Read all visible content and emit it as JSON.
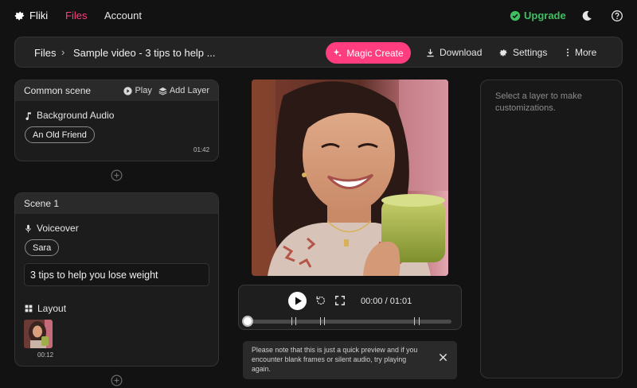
{
  "nav": {
    "brand": "Fliki",
    "files": "Files",
    "account": "Account",
    "upgrade": "Upgrade"
  },
  "toolbar": {
    "breadcrumb_root": "Files",
    "separator": "›",
    "title": "Sample video - 3 tips to help ...",
    "magic_create": "Magic Create",
    "download": "Download",
    "settings": "Settings",
    "more": "More"
  },
  "common_scene": {
    "title": "Common scene",
    "play": "Play",
    "add_layer": "Add Layer",
    "audio_label": "Background Audio",
    "audio_track": "An Old Friend",
    "duration": "01:42"
  },
  "scene1": {
    "title": "Scene 1",
    "voiceover_label": "Voiceover",
    "voice": "Sara",
    "script_text": "3 tips to help you lose weight",
    "layout_label": "Layout",
    "media_duration": "00:12"
  },
  "player": {
    "time": "00:00 / 01:01",
    "progress": 0
  },
  "notice": {
    "text": "Please note that this is just a quick preview and if you encounter blank frames or silent audio, try playing again."
  },
  "right_panel": {
    "hint": "Select a layer to make customizations."
  },
  "colors": {
    "accent": "#ff3d7f",
    "upgrade": "#3fbf62",
    "background": "#121212"
  },
  "icons": [
    "gear-icon",
    "check-badge-icon",
    "moon-icon",
    "help-icon",
    "sparkle-icon",
    "download-icon",
    "settings-icon",
    "more-icon",
    "play-icon",
    "layers-icon",
    "music-note-icon",
    "mic-icon",
    "layout-grid-icon",
    "plus-circle-icon",
    "replay-icon",
    "fullscreen-icon",
    "close-icon"
  ]
}
